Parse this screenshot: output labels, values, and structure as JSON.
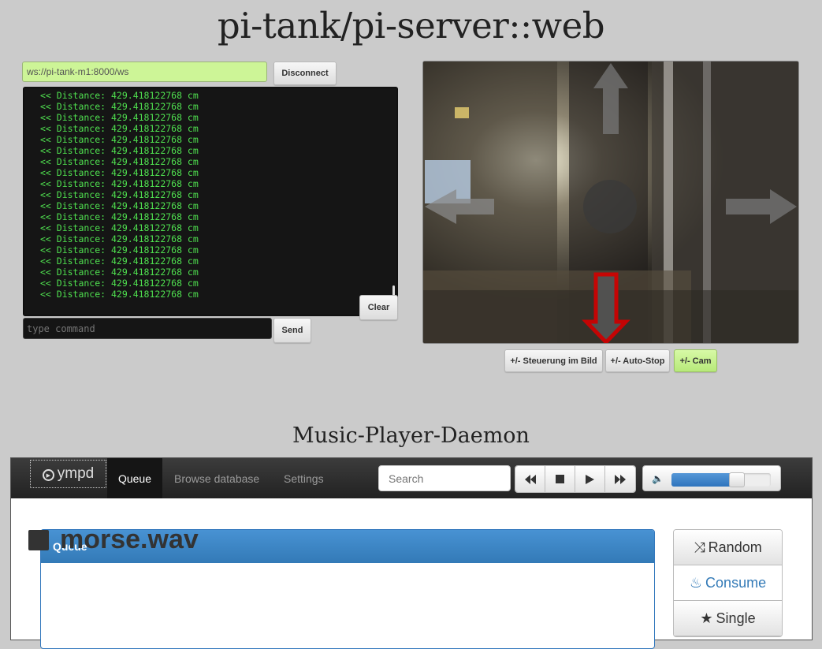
{
  "page_title": "pi-tank/pi-server::web",
  "connection": {
    "url": "ws://pi-tank-m1:8000/ws",
    "disconnect_label": "Disconnect"
  },
  "console": {
    "lines": [
      "<< Distance: 429.418122768 cm",
      "<< Distance: 429.418122768 cm",
      "<< Distance: 429.418122768 cm",
      "<< Distance: 429.418122768 cm",
      "<< Distance: 429.418122768 cm",
      "<< Distance: 429.418122768 cm",
      "<< Distance: 429.418122768 cm",
      "<< Distance: 429.418122768 cm",
      "<< Distance: 429.418122768 cm",
      "<< Distance: 429.418122768 cm",
      "<< Distance: 429.418122768 cm",
      "<< Distance: 429.418122768 cm",
      "<< Distance: 429.418122768 cm",
      "<< Distance: 429.418122768 cm",
      "<< Distance: 429.418122768 cm",
      "<< Distance: 429.418122768 cm",
      "<< Distance: 429.418122768 cm",
      "<< Distance: 429.418122768 cm",
      "<< Distance: 429.418122768 cm"
    ],
    "clear_label": "Clear",
    "command_placeholder": "type command",
    "send_label": "Send",
    "text_color": "#4fe04f"
  },
  "camera": {
    "controls": [
      "arrow-up-icon",
      "arrow-left-icon",
      "center-stop-icon",
      "arrow-right-icon",
      "arrow-down-icon"
    ],
    "active_control": "arrow-down-icon",
    "active_color": "#d40000",
    "toggles": {
      "steer_label": "+/- Steuerung im Bild",
      "autostop_label": "+/- Auto-Stop",
      "cam_label": "+/- Cam"
    }
  },
  "mpd": {
    "title": "Music-Player-Daemon",
    "brand": "ympd",
    "nav": {
      "queue": "Queue",
      "browse": "Browse database",
      "settings": "Settings"
    },
    "search_placeholder": "Search",
    "transport_icons": [
      "rewind-icon",
      "stop-icon",
      "play-icon",
      "fast-forward-icon"
    ],
    "volume_percent": 66,
    "volume_color": "#337ab7",
    "queue": {
      "heading": "Queue",
      "current_track": "morse.wav"
    },
    "modes": {
      "random": "Random",
      "consume": "Consume",
      "single": "Single"
    }
  }
}
